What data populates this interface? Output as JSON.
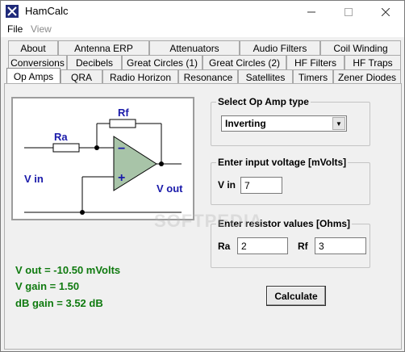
{
  "window": {
    "title": "HamCalc"
  },
  "menu": {
    "file": "File",
    "view": "View"
  },
  "tabs": {
    "row1": [
      "About",
      "Antenna ERP",
      "Attenuators",
      "Audio Filters",
      "Coil Winding"
    ],
    "row2": [
      "Conversions",
      "Decibels",
      "Great Circles (1)",
      "Great Circles (2)",
      "HF Filters",
      "HF Traps"
    ],
    "row3": [
      "Op Amps",
      "QRA",
      "Radio Horizon",
      "Resonance",
      "Satellites",
      "Timers",
      "Zener Diodes"
    ],
    "active": "Op Amps"
  },
  "schematic": {
    "rf_label": "Rf",
    "ra_label": "Ra",
    "minus": "−",
    "plus": "+",
    "vin_label": "V in",
    "vout_label": "V out"
  },
  "op_amp_type": {
    "label": "Select Op Amp type",
    "selected": "Inverting"
  },
  "input_voltage": {
    "label": "Enter input voltage  [mVolts]",
    "vin_label": "V in",
    "vin_value": "7"
  },
  "resistors": {
    "label": "Enter resistor values  [Ohms]",
    "ra_label": "Ra",
    "ra_value": "2",
    "rf_label": "Rf",
    "rf_value": "3"
  },
  "results": {
    "vout": "V out = -10.50 mVolts",
    "vgain": "V gain = 1.50",
    "dbgain": "dB gain = 3.52 dB"
  },
  "calculate_label": "Calculate",
  "watermark": "SOFTPEDIA",
  "colors": {
    "result_green": "#0f7a0f",
    "schematic_blue": "#1a1aaa",
    "opamp_fill": "#a8c4a8"
  }
}
